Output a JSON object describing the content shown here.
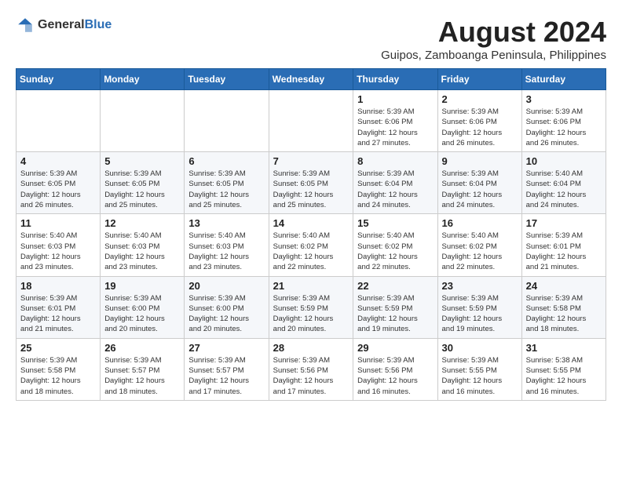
{
  "header": {
    "logo_general": "General",
    "logo_blue": "Blue",
    "month_year": "August 2024",
    "location": "Guipos, Zamboanga Peninsula, Philippines"
  },
  "days_of_week": [
    "Sunday",
    "Monday",
    "Tuesday",
    "Wednesday",
    "Thursday",
    "Friday",
    "Saturday"
  ],
  "weeks": [
    [
      {
        "day": "",
        "info": ""
      },
      {
        "day": "",
        "info": ""
      },
      {
        "day": "",
        "info": ""
      },
      {
        "day": "",
        "info": ""
      },
      {
        "day": "1",
        "info": "Sunrise: 5:39 AM\nSunset: 6:06 PM\nDaylight: 12 hours\nand 27 minutes."
      },
      {
        "day": "2",
        "info": "Sunrise: 5:39 AM\nSunset: 6:06 PM\nDaylight: 12 hours\nand 26 minutes."
      },
      {
        "day": "3",
        "info": "Sunrise: 5:39 AM\nSunset: 6:06 PM\nDaylight: 12 hours\nand 26 minutes."
      }
    ],
    [
      {
        "day": "4",
        "info": "Sunrise: 5:39 AM\nSunset: 6:05 PM\nDaylight: 12 hours\nand 26 minutes."
      },
      {
        "day": "5",
        "info": "Sunrise: 5:39 AM\nSunset: 6:05 PM\nDaylight: 12 hours\nand 25 minutes."
      },
      {
        "day": "6",
        "info": "Sunrise: 5:39 AM\nSunset: 6:05 PM\nDaylight: 12 hours\nand 25 minutes."
      },
      {
        "day": "7",
        "info": "Sunrise: 5:39 AM\nSunset: 6:05 PM\nDaylight: 12 hours\nand 25 minutes."
      },
      {
        "day": "8",
        "info": "Sunrise: 5:39 AM\nSunset: 6:04 PM\nDaylight: 12 hours\nand 24 minutes."
      },
      {
        "day": "9",
        "info": "Sunrise: 5:39 AM\nSunset: 6:04 PM\nDaylight: 12 hours\nand 24 minutes."
      },
      {
        "day": "10",
        "info": "Sunrise: 5:40 AM\nSunset: 6:04 PM\nDaylight: 12 hours\nand 24 minutes."
      }
    ],
    [
      {
        "day": "11",
        "info": "Sunrise: 5:40 AM\nSunset: 6:03 PM\nDaylight: 12 hours\nand 23 minutes."
      },
      {
        "day": "12",
        "info": "Sunrise: 5:40 AM\nSunset: 6:03 PM\nDaylight: 12 hours\nand 23 minutes."
      },
      {
        "day": "13",
        "info": "Sunrise: 5:40 AM\nSunset: 6:03 PM\nDaylight: 12 hours\nand 23 minutes."
      },
      {
        "day": "14",
        "info": "Sunrise: 5:40 AM\nSunset: 6:02 PM\nDaylight: 12 hours\nand 22 minutes."
      },
      {
        "day": "15",
        "info": "Sunrise: 5:40 AM\nSunset: 6:02 PM\nDaylight: 12 hours\nand 22 minutes."
      },
      {
        "day": "16",
        "info": "Sunrise: 5:40 AM\nSunset: 6:02 PM\nDaylight: 12 hours\nand 22 minutes."
      },
      {
        "day": "17",
        "info": "Sunrise: 5:39 AM\nSunset: 6:01 PM\nDaylight: 12 hours\nand 21 minutes."
      }
    ],
    [
      {
        "day": "18",
        "info": "Sunrise: 5:39 AM\nSunset: 6:01 PM\nDaylight: 12 hours\nand 21 minutes."
      },
      {
        "day": "19",
        "info": "Sunrise: 5:39 AM\nSunset: 6:00 PM\nDaylight: 12 hours\nand 20 minutes."
      },
      {
        "day": "20",
        "info": "Sunrise: 5:39 AM\nSunset: 6:00 PM\nDaylight: 12 hours\nand 20 minutes."
      },
      {
        "day": "21",
        "info": "Sunrise: 5:39 AM\nSunset: 5:59 PM\nDaylight: 12 hours\nand 20 minutes."
      },
      {
        "day": "22",
        "info": "Sunrise: 5:39 AM\nSunset: 5:59 PM\nDaylight: 12 hours\nand 19 minutes."
      },
      {
        "day": "23",
        "info": "Sunrise: 5:39 AM\nSunset: 5:59 PM\nDaylight: 12 hours\nand 19 minutes."
      },
      {
        "day": "24",
        "info": "Sunrise: 5:39 AM\nSunset: 5:58 PM\nDaylight: 12 hours\nand 18 minutes."
      }
    ],
    [
      {
        "day": "25",
        "info": "Sunrise: 5:39 AM\nSunset: 5:58 PM\nDaylight: 12 hours\nand 18 minutes."
      },
      {
        "day": "26",
        "info": "Sunrise: 5:39 AM\nSunset: 5:57 PM\nDaylight: 12 hours\nand 18 minutes."
      },
      {
        "day": "27",
        "info": "Sunrise: 5:39 AM\nSunset: 5:57 PM\nDaylight: 12 hours\nand 17 minutes."
      },
      {
        "day": "28",
        "info": "Sunrise: 5:39 AM\nSunset: 5:56 PM\nDaylight: 12 hours\nand 17 minutes."
      },
      {
        "day": "29",
        "info": "Sunrise: 5:39 AM\nSunset: 5:56 PM\nDaylight: 12 hours\nand 16 minutes."
      },
      {
        "day": "30",
        "info": "Sunrise: 5:39 AM\nSunset: 5:55 PM\nDaylight: 12 hours\nand 16 minutes."
      },
      {
        "day": "31",
        "info": "Sunrise: 5:38 AM\nSunset: 5:55 PM\nDaylight: 12 hours\nand 16 minutes."
      }
    ]
  ]
}
